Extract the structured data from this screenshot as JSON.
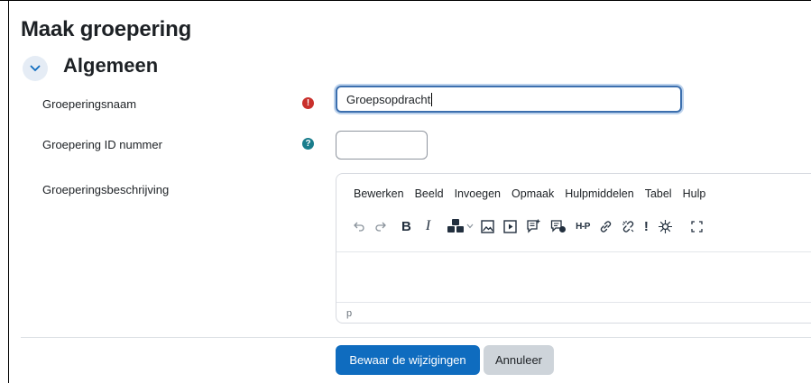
{
  "page": {
    "title": "Maak groepering"
  },
  "section": {
    "title": "Algemeen"
  },
  "fields": {
    "name": {
      "label": "Groeperingsnaam",
      "value": "Groepsopdracht"
    },
    "idnumber": {
      "label": "Groepering ID nummer",
      "value": ""
    },
    "description": {
      "label": "Groeperingsbeschrijving"
    }
  },
  "editor": {
    "menu": [
      "Bewerken",
      "Beeld",
      "Invoegen",
      "Opmaak",
      "Hulpmiddelen",
      "Tabel",
      "Hulp"
    ],
    "toolbar": {
      "bold": "B",
      "italic": "I",
      "h5p": "H-P",
      "exclamation": "!"
    },
    "statusbar": "p"
  },
  "buttons": {
    "save": "Bewaar de wijzigingen",
    "cancel": "Annuleer"
  },
  "colors": {
    "primary": "#0f6cbf",
    "required": "#c9302c",
    "help": "#1a7d8c"
  }
}
